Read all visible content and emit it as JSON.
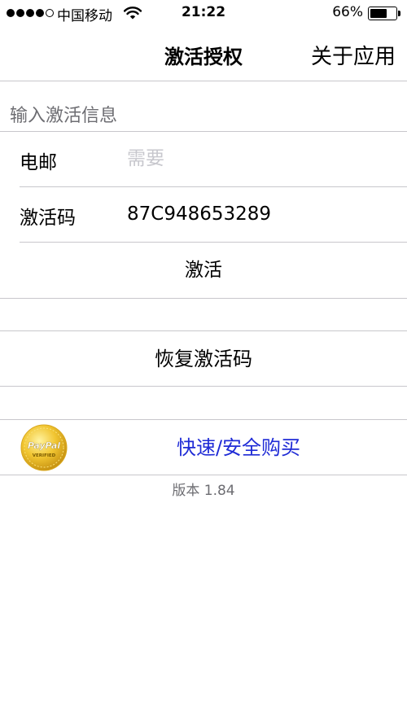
{
  "status_bar": {
    "carrier": "中国移动",
    "time": "21:22",
    "battery_percent": "66%",
    "battery_level": 0.66,
    "signal_bars_filled": 4,
    "signal_bars_total": 5
  },
  "nav": {
    "title": "激活授权",
    "about_label": "关于应用"
  },
  "form": {
    "section_header": "输入激活信息",
    "email_label": "电邮",
    "email_placeholder": "需要",
    "email_value": "",
    "code_label": "激活码",
    "code_value": "87C948653289",
    "activate_label": "激活"
  },
  "restore": {
    "label": "恢复激活码"
  },
  "buy": {
    "label": "快速/安全购买",
    "badge_text_top": "PayPal",
    "badge_text_bottom": "VERIFIED",
    "link_color": "#1f2bd6"
  },
  "footer": {
    "version": "版本 1.84"
  }
}
